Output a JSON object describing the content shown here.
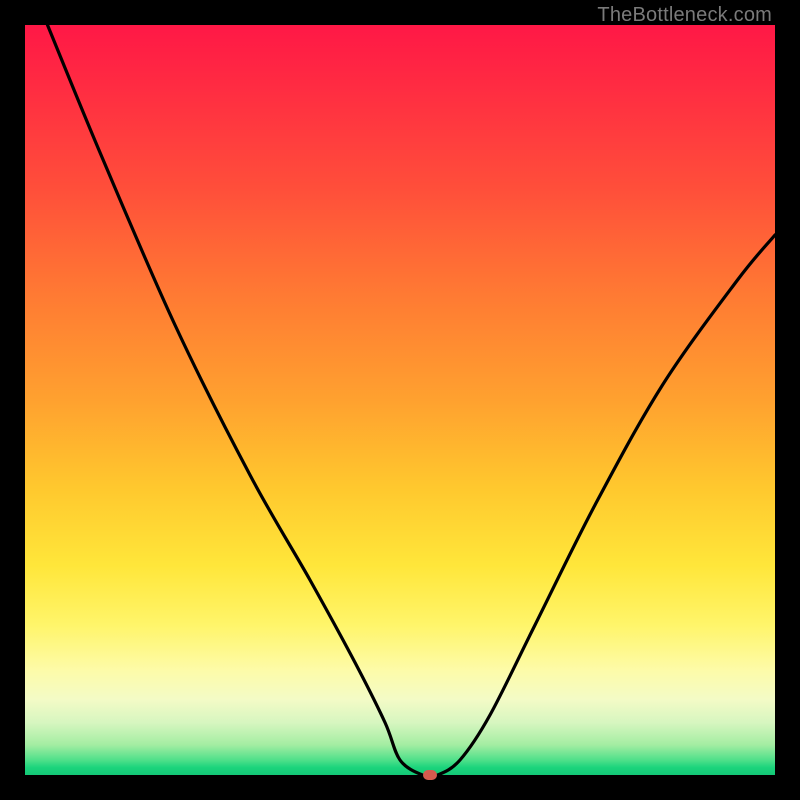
{
  "watermark": "TheBottleneck.com",
  "chart_data": {
    "type": "line",
    "title": "",
    "xlabel": "",
    "ylabel": "",
    "xlim": [
      0,
      100
    ],
    "ylim": [
      0,
      100
    ],
    "grid": false,
    "series": [
      {
        "name": "bottleneck-curve",
        "x": [
          3,
          10,
          20,
          30,
          38,
          44,
          48,
          50,
          53,
          55,
          58,
          62,
          68,
          76,
          85,
          95,
          100
        ],
        "y": [
          100,
          83,
          60,
          40,
          26,
          15,
          7,
          2,
          0,
          0,
          2,
          8,
          20,
          36,
          52,
          66,
          72
        ]
      }
    ],
    "marker": {
      "x": 54,
      "y": 0,
      "color": "#d65a4e"
    },
    "background_gradient": {
      "top": "#ff1846",
      "mid": "#ffe63a",
      "bottom": "#14c877"
    }
  }
}
